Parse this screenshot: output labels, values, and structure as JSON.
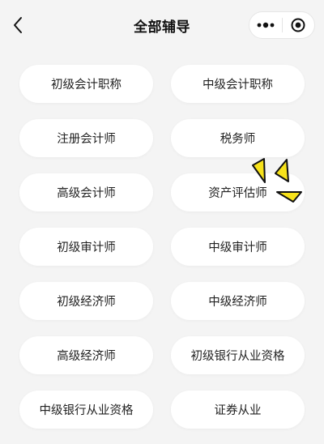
{
  "nav": {
    "title": "全部辅导",
    "back_icon": "chevron-left-icon",
    "more_icon": "more-dots-icon",
    "close_icon": "target-close-icon"
  },
  "courses": [
    "初级会计职称",
    "中级会计职称",
    "注册会计师",
    "税务师",
    "高级会计师",
    "资产评估师",
    "初级审计师",
    "中级审计师",
    "初级经济师",
    "中级经济师",
    "高级经济师",
    "初级银行从业资格",
    "中级银行从业资格",
    "证券从业"
  ],
  "colors": {
    "background": "#f4f4f4",
    "button_bg": "#ffffff",
    "sparkle_fill": "#f7e21a",
    "sparkle_stroke": "#111111"
  }
}
